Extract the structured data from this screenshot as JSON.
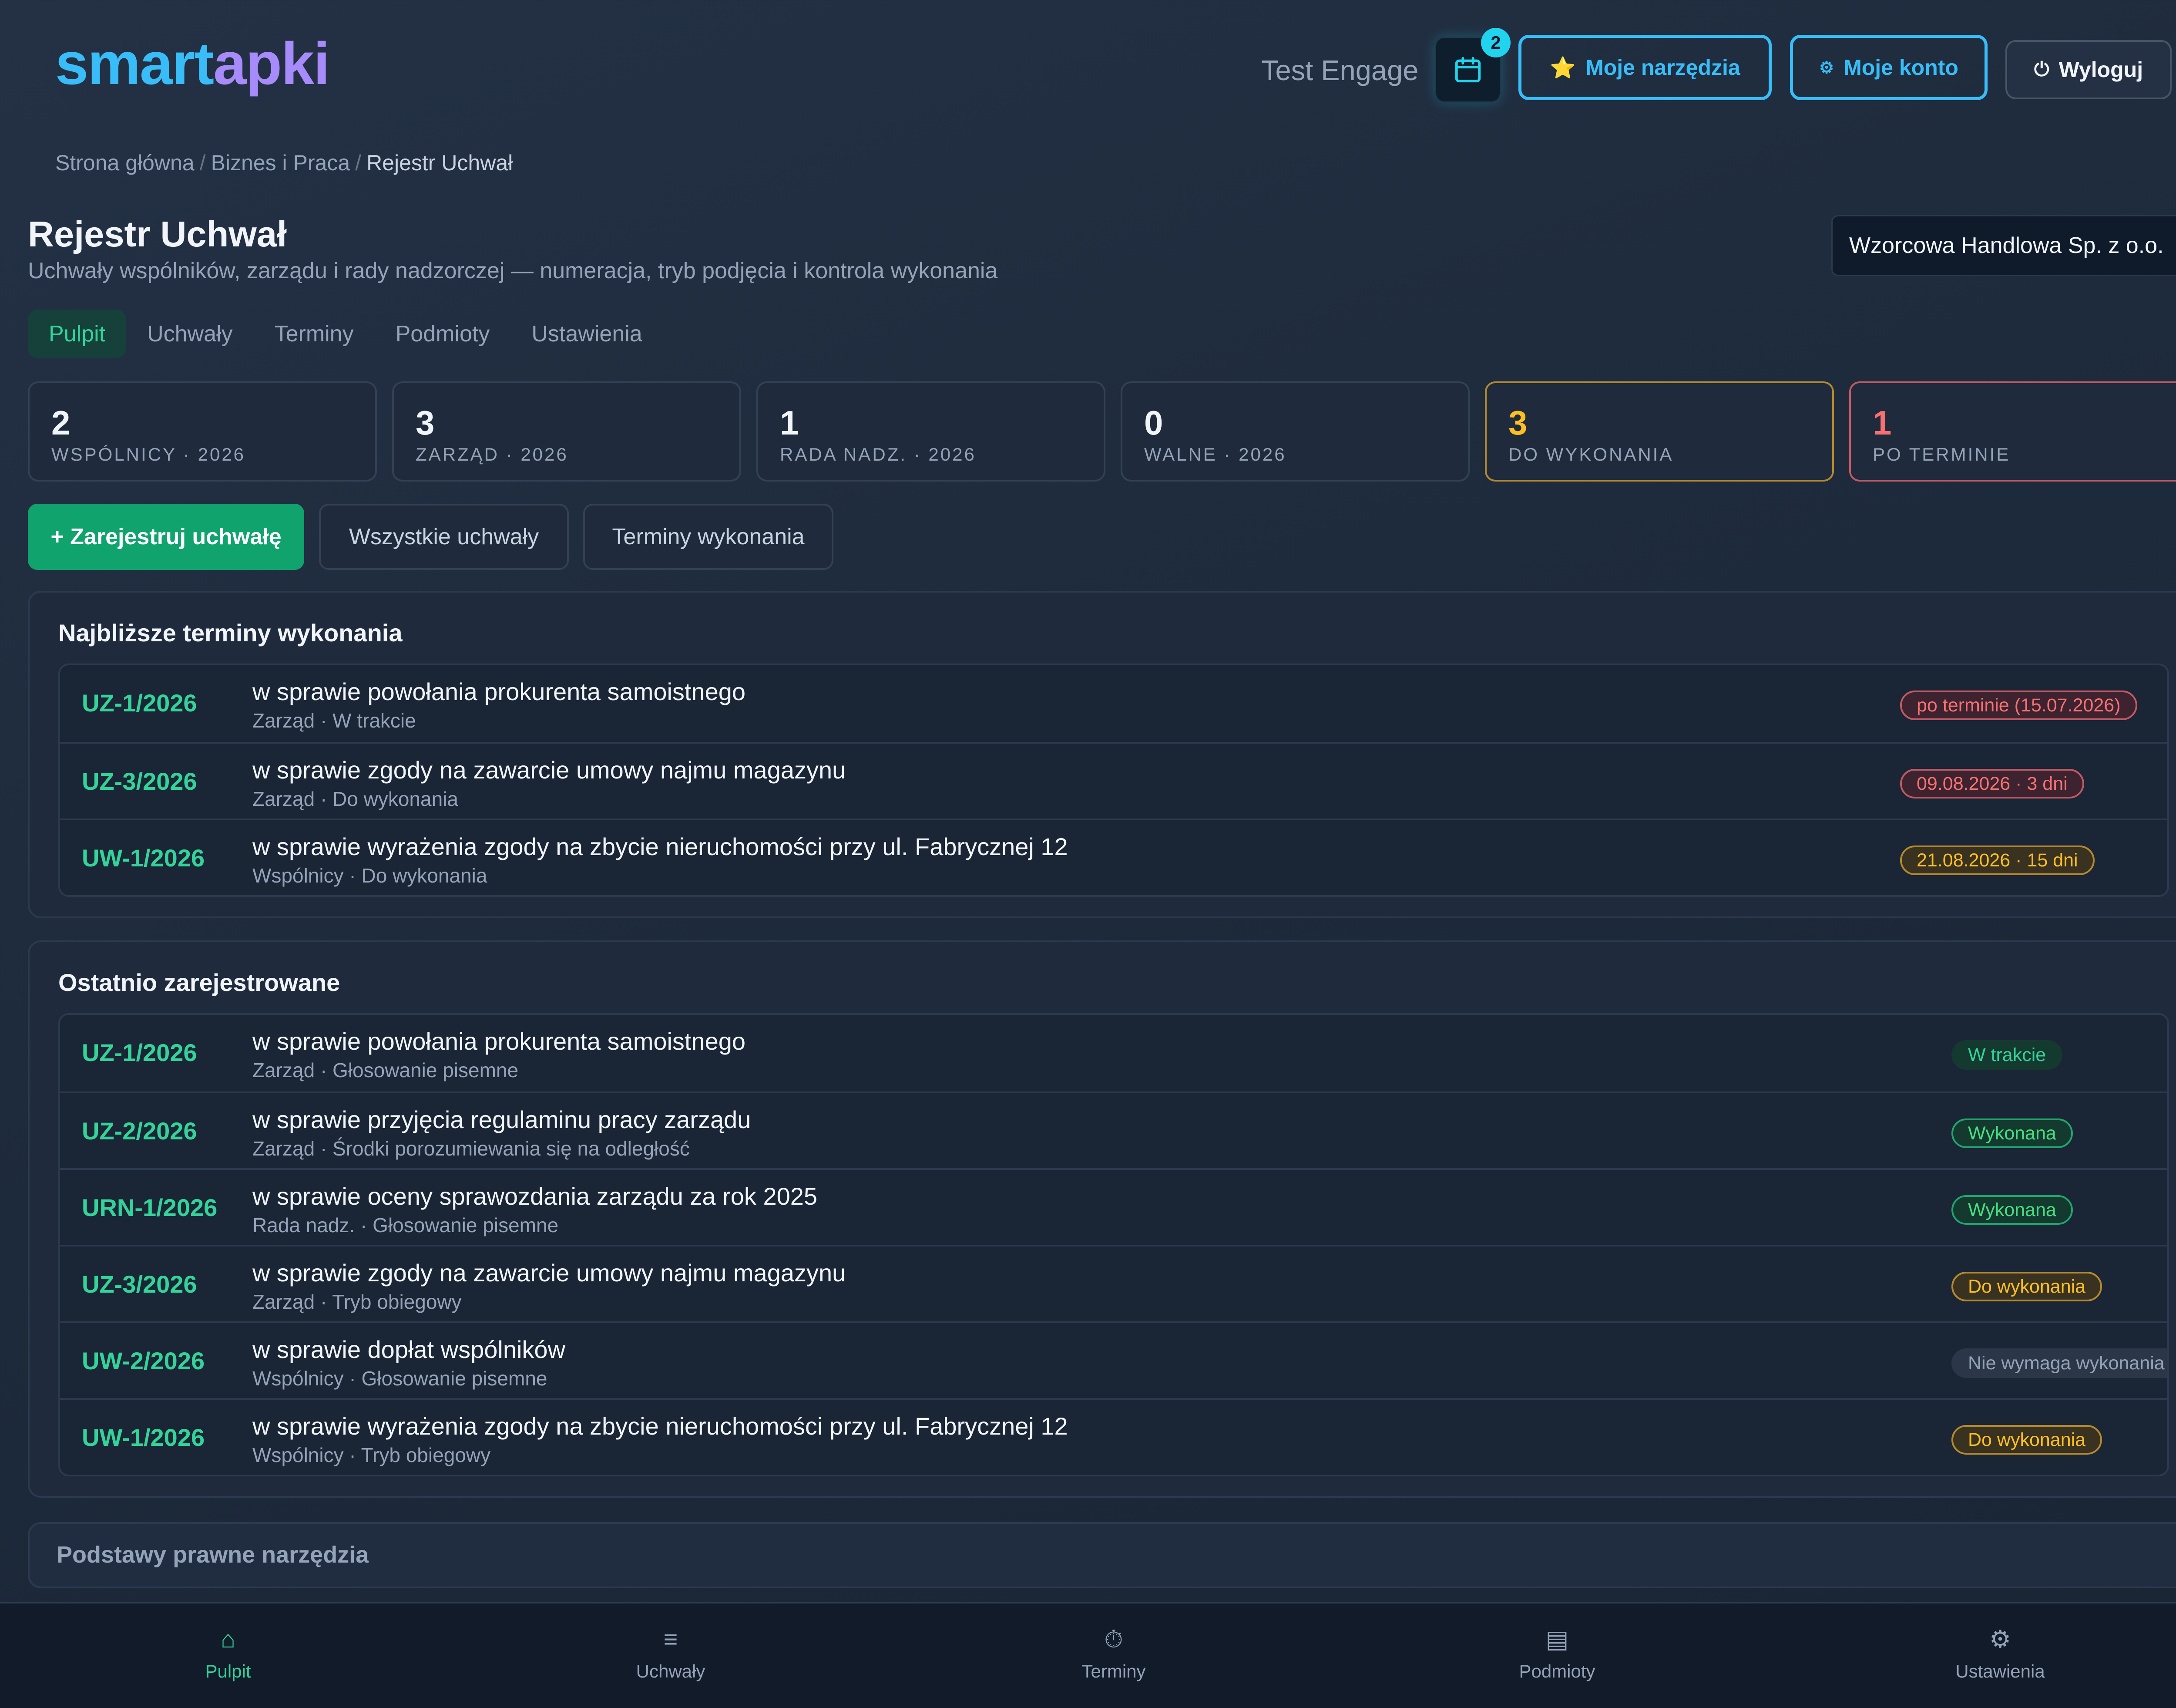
{
  "header": {
    "logo_a": "smart",
    "logo_b": "apki",
    "user_name": "Test Engage",
    "calendar_badge": "2",
    "tools_label": "Moje narzędzia",
    "account_label": "Moje konto",
    "logout_label": "Wyloguj"
  },
  "breadcrumb": [
    "Strona główna",
    "Biznes i Praca",
    "Rejestr Uchwał"
  ],
  "page": {
    "title": "Rejestr Uchwał",
    "subtitle": "Uchwały wspólników, zarządu i rady nadzorczej — numeracja, tryb podjęcia i kontrola wykonania",
    "company": "Wzorcowa Handlowa Sp. z o.o."
  },
  "tabs": [
    "Pulpit",
    "Uchwały",
    "Terminy",
    "Podmioty",
    "Ustawienia"
  ],
  "stats": [
    {
      "value": "2",
      "label": "WSPÓLNICY · 2026"
    },
    {
      "value": "3",
      "label": "ZARZĄD · 2026"
    },
    {
      "value": "1",
      "label": "RADA NADZ. · 2026"
    },
    {
      "value": "0",
      "label": "WALNE · 2026"
    },
    {
      "value": "3",
      "label": "DO WYKONANIA"
    },
    {
      "value": "1",
      "label": "PO TERMINIE"
    }
  ],
  "actions": {
    "register": "+ Zarejestruj uchwałę",
    "all": "Wszystkie uchwały",
    "deadlines": "Terminy wykonania"
  },
  "upcoming": {
    "title": "Najbliższe terminy wykonania",
    "rows": [
      {
        "num": "UZ-1/2026",
        "title": "w sprawie powołania prokurenta samoistnego",
        "sub": "Zarząd · W trakcie",
        "badge": "po terminie (15.07.2026)"
      },
      {
        "num": "UZ-3/2026",
        "title": "w sprawie zgody na zawarcie umowy najmu magazynu",
        "sub": "Zarząd · Do wykonania",
        "badge": "09.08.2026 · 3 dni"
      },
      {
        "num": "UW-1/2026",
        "title": "w sprawie wyrażenia zgody na zbycie nieruchomości przy ul. Fabrycznej 12",
        "sub": "Wspólnicy · Do wykonania",
        "badge": "21.08.2026 · 15 dni"
      }
    ]
  },
  "recent": {
    "title": "Ostatnio zarejestrowane",
    "rows": [
      {
        "num": "UZ-1/2026",
        "title": "w sprawie powołania prokurenta samoistnego",
        "sub": "Zarząd · Głosowanie pisemne",
        "badge": "W trakcie"
      },
      {
        "num": "UZ-2/2026",
        "title": "w sprawie przyjęcia regulaminu pracy zarządu",
        "sub": "Zarząd · Środki porozumiewania się na odległość",
        "badge": "Wykonana"
      },
      {
        "num": "URN-1/2026",
        "title": "w sprawie oceny sprawozdania zarządu za rok 2025",
        "sub": "Rada nadz. · Głosowanie pisemne",
        "badge": "Wykonana"
      },
      {
        "num": "UZ-3/2026",
        "title": "w sprawie zgody na zawarcie umowy najmu magazynu",
        "sub": "Zarząd · Tryb obiegowy",
        "badge": "Do wykonania"
      },
      {
        "num": "UW-2/2026",
        "title": "w sprawie dopłat wspólników",
        "sub": "Wspólnicy · Głosowanie pisemne",
        "badge": "Nie wymaga wykonania"
      },
      {
        "num": "UW-1/2026",
        "title": "w sprawie wyrażenia zgody na zbycie nieruchomości przy ul. Fabrycznej 12",
        "sub": "Wspólnicy · Tryb obiegowy",
        "badge": "Do wykonania"
      }
    ]
  },
  "legal": "Podstawy prawne narzędzia",
  "bottom_nav": [
    {
      "icon": "home-icon",
      "label": "Pulpit"
    },
    {
      "icon": "list-icon",
      "label": "Uchwały"
    },
    {
      "icon": "stopwatch-icon",
      "label": "Terminy"
    },
    {
      "icon": "building-icon",
      "label": "Podmioty"
    },
    {
      "icon": "gear-icon",
      "label": "Ustawienia"
    }
  ],
  "colors": {
    "accent_blue": "#38bdf8",
    "accent_purple": "#a78bfa",
    "accent_green": "#34d399",
    "warn": "#fbbf24",
    "danger": "#f87171"
  }
}
